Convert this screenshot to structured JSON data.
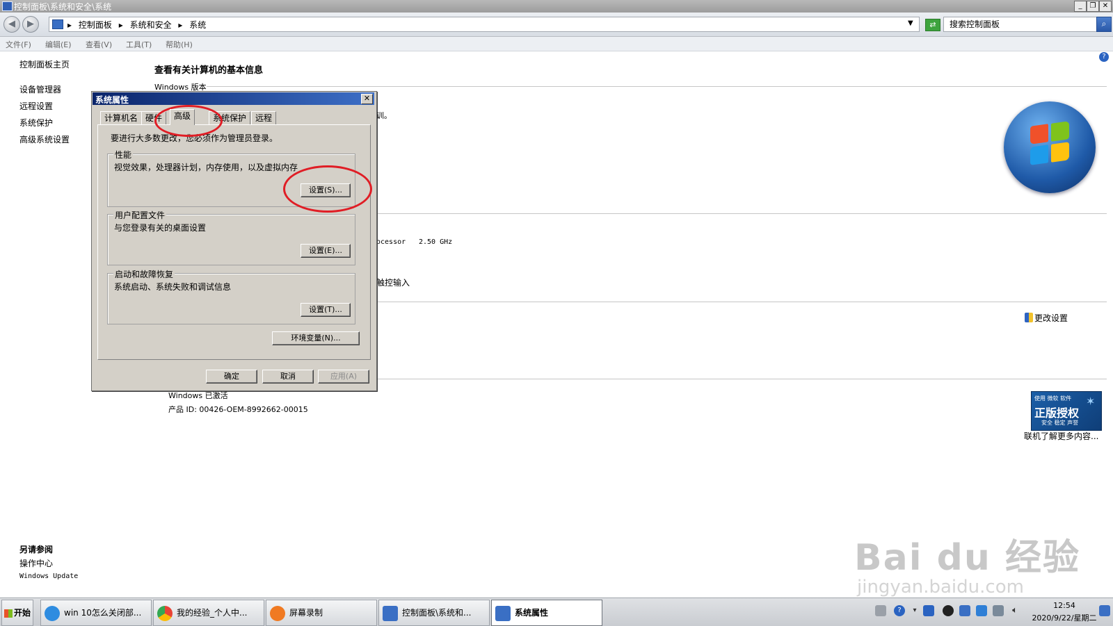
{
  "window": {
    "title": "控制面板\\系统和安全\\系统",
    "buttons": {
      "minimize": "_",
      "restore": "❐",
      "close": "✕"
    }
  },
  "address_bar": {
    "crumbs": [
      "控制面板",
      "系统和安全",
      "系统"
    ],
    "search_placeholder": "搜索控制面板"
  },
  "menu": [
    "文件(F)",
    "编辑(E)",
    "查看(V)",
    "工具(T)",
    "帮助(H)"
  ],
  "sidebar": {
    "home": "控制面板主页",
    "links": [
      "设备管理器",
      "远程设置",
      "系统保护",
      "高级系统设置"
    ],
    "see_also_title": "另请参阅",
    "see_also": [
      "操作中心",
      "Windows Update"
    ]
  },
  "main": {
    "heading": "查看有关计算机的基本信息",
    "edition_label": "Windows 版本",
    "edition_fragment": "训。",
    "processor_fragment": "ocessor",
    "processor_speed": "2.50 GHz",
    "touch_fragment": "触控输入",
    "change_settings": "更改设置",
    "activation_status": "Windows 已激活",
    "product_id": "产品 ID: 00426-OEM-8992662-00015",
    "learn_more": "联机了解更多内容..."
  },
  "genuine_badge": {
    "top": "使用 微软 软件",
    "main": "正版授权",
    "sub": "安全 稳定 声誉"
  },
  "dialog": {
    "title": "系统属性",
    "close": "✕",
    "tabs": [
      "计算机名",
      "硬件",
      "高级",
      "系统保护",
      "远程"
    ],
    "notice": "要进行大多数更改，您必须作为管理员登录。",
    "performance": {
      "label": "性能",
      "desc": "视觉效果，处理器计划，内存使用，以及虚拟内存",
      "button": "设置(S)..."
    },
    "user_profiles": {
      "label": "用户配置文件",
      "desc": "与您登录有关的桌面设置",
      "button": "设置(E)..."
    },
    "startup": {
      "label": "启动和故障恢复",
      "desc": "系统启动、系统失败和调试信息",
      "button": "设置(T)..."
    },
    "env_button": "环境变量(N)...",
    "ok": "确定",
    "cancel": "取消",
    "apply": "应用(A)"
  },
  "taskbar": {
    "start": "开始",
    "tasks": [
      "win 10怎么关闭部...",
      "我的经验_个人中...",
      "屏幕录制",
      "控制面板\\系统和...",
      "系统属性"
    ],
    "clock_time": "12:54",
    "clock_date": "2020/9/22/星期二"
  },
  "watermark": {
    "text": "Bai du 经验",
    "sub": "jingyan.baidu.com"
  },
  "colors": {
    "accent": "#0a246a",
    "highlight": "#e01d25"
  }
}
